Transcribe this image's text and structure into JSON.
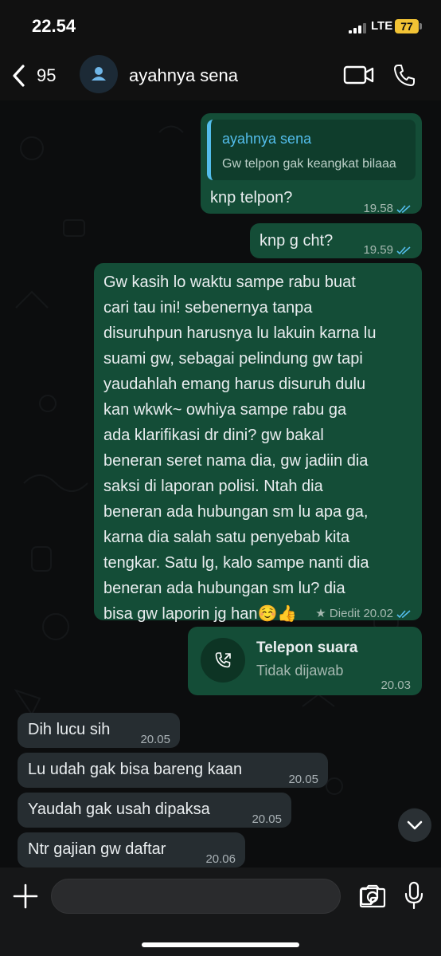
{
  "status": {
    "time": "22.54",
    "network": "LTE",
    "battery": "77"
  },
  "header": {
    "back_count": "95",
    "contact_name": "ayahnya sena"
  },
  "messages": {
    "m1": {
      "quote_name": "ayahnya sena",
      "quote_text": "Gw telpon gak keangkat bilaaa",
      "text": "knp telpon?",
      "time": "19.58"
    },
    "m2": {
      "text": "knp g cht?",
      "time": "19.59"
    },
    "m3": {
      "lines": [
        "Gw kasih lo waktu sampe rabu buat",
        "cari tau ini! sebenernya tanpa",
        "disuruhpun harusnya lu lakuin karna lu",
        "suami gw, sebagai pelindung gw tapi",
        "yaudahlah emang harus disuruh dulu",
        "kan wkwk~ owhiya sampe rabu ga",
        "ada klarifikasi dr dini? gw bakal",
        "beneran seret nama dia, gw jadiin dia",
        "saksi di laporan polisi. Ntah dia",
        "beneran ada hubungan sm lu apa ga,",
        "karna dia salah satu penyebab kita",
        "tengkar. Satu lg, kalo sampe nanti dia",
        "beneran ada hubungan sm lu? dia",
        "bisa gw laporin jg han☺️👍"
      ],
      "edited": "Diedit",
      "time": "20.02"
    },
    "m4": {
      "title": "Telepon suara",
      "subtitle": "Tidak dijawab",
      "time": "20.03"
    },
    "m5": {
      "text": "Dih lucu sih",
      "time": "20.05"
    },
    "m6": {
      "text": "Lu udah gak bisa bareng kaan",
      "time": "20.05"
    },
    "m7": {
      "text": "Yaudah gak usah dipaksa",
      "time": "20.05"
    },
    "m8": {
      "text": "Ntr gajian gw daftar",
      "time": "20.06"
    }
  },
  "composer": {
    "placeholder": ""
  },
  "icons": {
    "back": "chevron-left-icon",
    "avatar": "person-icon",
    "video": "video-camera-icon",
    "call": "phone-icon",
    "plus": "plus-icon",
    "sticker": "sticker-icon",
    "camera": "camera-icon",
    "mic": "microphone-icon",
    "scroll": "chevron-down-icon"
  },
  "colors": {
    "outgoing": "#144d37",
    "incoming": "#262d31",
    "accent": "#53bdeb",
    "ticks": "#53bdeb",
    "battery": "#f2c335"
  }
}
